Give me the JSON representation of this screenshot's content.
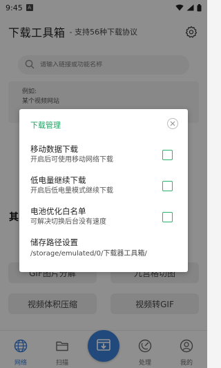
{
  "status_bar": {
    "time": "9:45",
    "notification_badge": "A",
    "icons": [
      "wifi-icon",
      "signal-icon",
      "battery-icon"
    ]
  },
  "header": {
    "title": "下载工具箱",
    "subtitle": "- 支持56种下载协议",
    "settings_icon": "gear-icon"
  },
  "search": {
    "placeholder": "请输入链接或功能名称",
    "icon": "search-icon"
  },
  "example_card": {
    "line1": "例如:",
    "line2": "某个视频网站"
  },
  "section_fragment": "其",
  "tools": [
    {
      "label": "GIF图片分解"
    },
    {
      "label": "九宫格切图"
    },
    {
      "label": "视频体积压缩"
    },
    {
      "label": "视频转GIF"
    }
  ],
  "bottom_nav": {
    "items": [
      {
        "label": "网络",
        "icon": "globe-icon",
        "active": true
      },
      {
        "label": "扫描",
        "icon": "folder-icon",
        "active": false
      },
      {
        "label": "处理",
        "icon": "satellite-dish-icon",
        "active": false
      },
      {
        "label": "我的",
        "icon": "user-icon",
        "active": false
      }
    ],
    "fab_icon": "download-icon"
  },
  "dialog": {
    "title": "下载管理",
    "close_icon": "close-icon",
    "options": [
      {
        "title": "移动数据下载",
        "desc": "开启后可使用移动网络下载",
        "checked": false
      },
      {
        "title": "低电量继续下载",
        "desc": "开启后低电量模式继续下载",
        "checked": false
      },
      {
        "title": "电池优化白名单",
        "desc": "可解决切换后台没有速度",
        "checked": false
      }
    ],
    "storage": {
      "title": "储存路径设置",
      "path": "/storage/emulated/0/下载器工具箱/"
    }
  },
  "colors": {
    "accent_green": "#1aa260",
    "checkbox_green": "#2ab36a",
    "primary_blue": "#3b7fd6"
  }
}
